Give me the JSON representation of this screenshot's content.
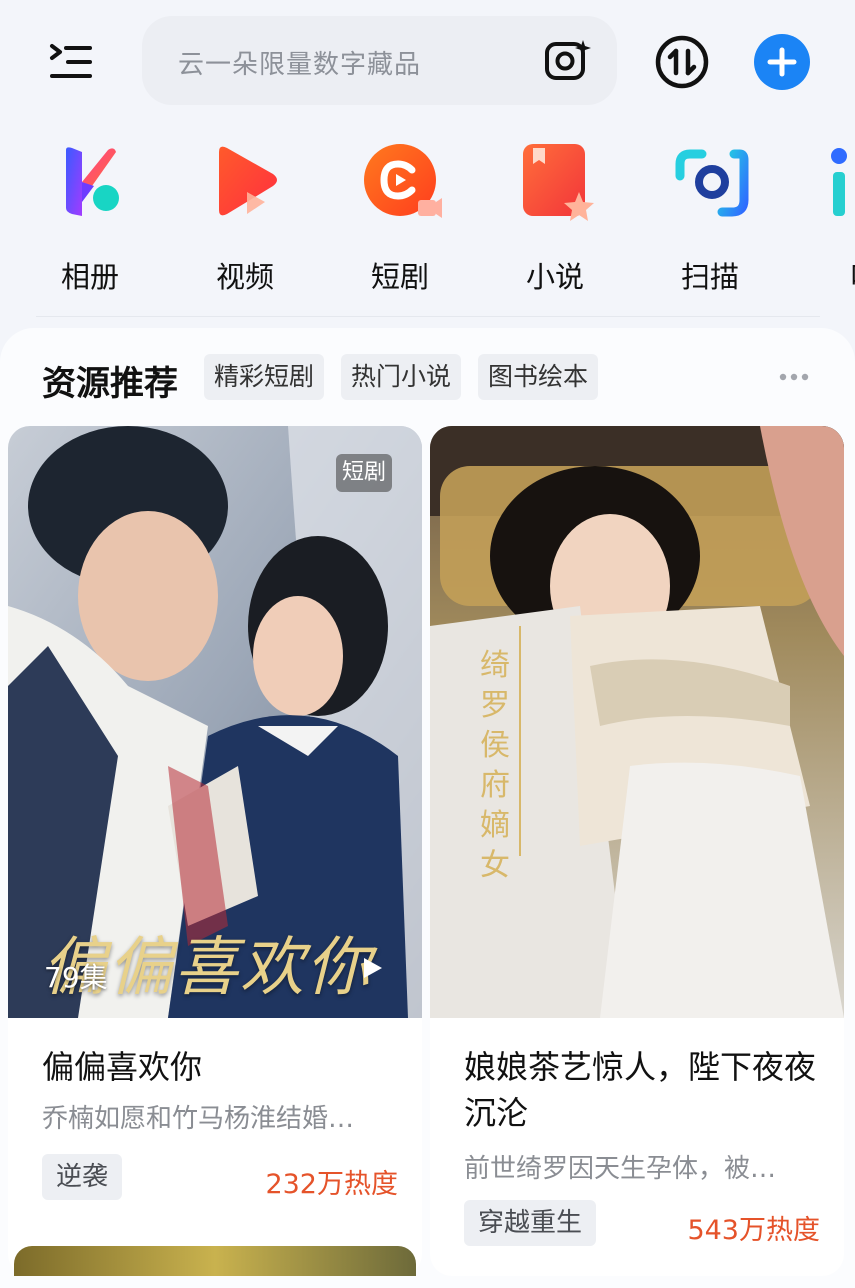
{
  "search": {
    "placeholder": "云一朵限量数字藏品"
  },
  "shortcuts": [
    {
      "label": "相册",
      "icon": "album-icon"
    },
    {
      "label": "视频",
      "icon": "video-icon"
    },
    {
      "label": "短剧",
      "icon": "short-drama-icon"
    },
    {
      "label": "小说",
      "icon": "novel-icon"
    },
    {
      "label": "扫描",
      "icon": "scan-icon"
    },
    {
      "label": "听",
      "icon": "listen-icon"
    }
  ],
  "recommend": {
    "title": "资源推荐",
    "chips": [
      "精彩短剧",
      "热门小说",
      "图书绘本"
    ]
  },
  "cards": [
    {
      "badge": "短剧",
      "episodes": "79集",
      "cover_caption": "偏偏喜欢你",
      "title": "偏偏喜欢你",
      "desc": "乔楠如愿和竹马杨淮结婚…",
      "tag": "逆袭",
      "heat": "232万热度"
    },
    {
      "cover_caption": "绮罗 侯府嫡女",
      "title": "娘娘茶艺惊人，陛下夜夜沉沦",
      "desc": "前世绮罗因天生孕体，被…",
      "tag": "穿越重生",
      "heat": "543万热度"
    }
  ],
  "colors": {
    "accent": "#1b84f5",
    "heat": "#e5532a"
  }
}
